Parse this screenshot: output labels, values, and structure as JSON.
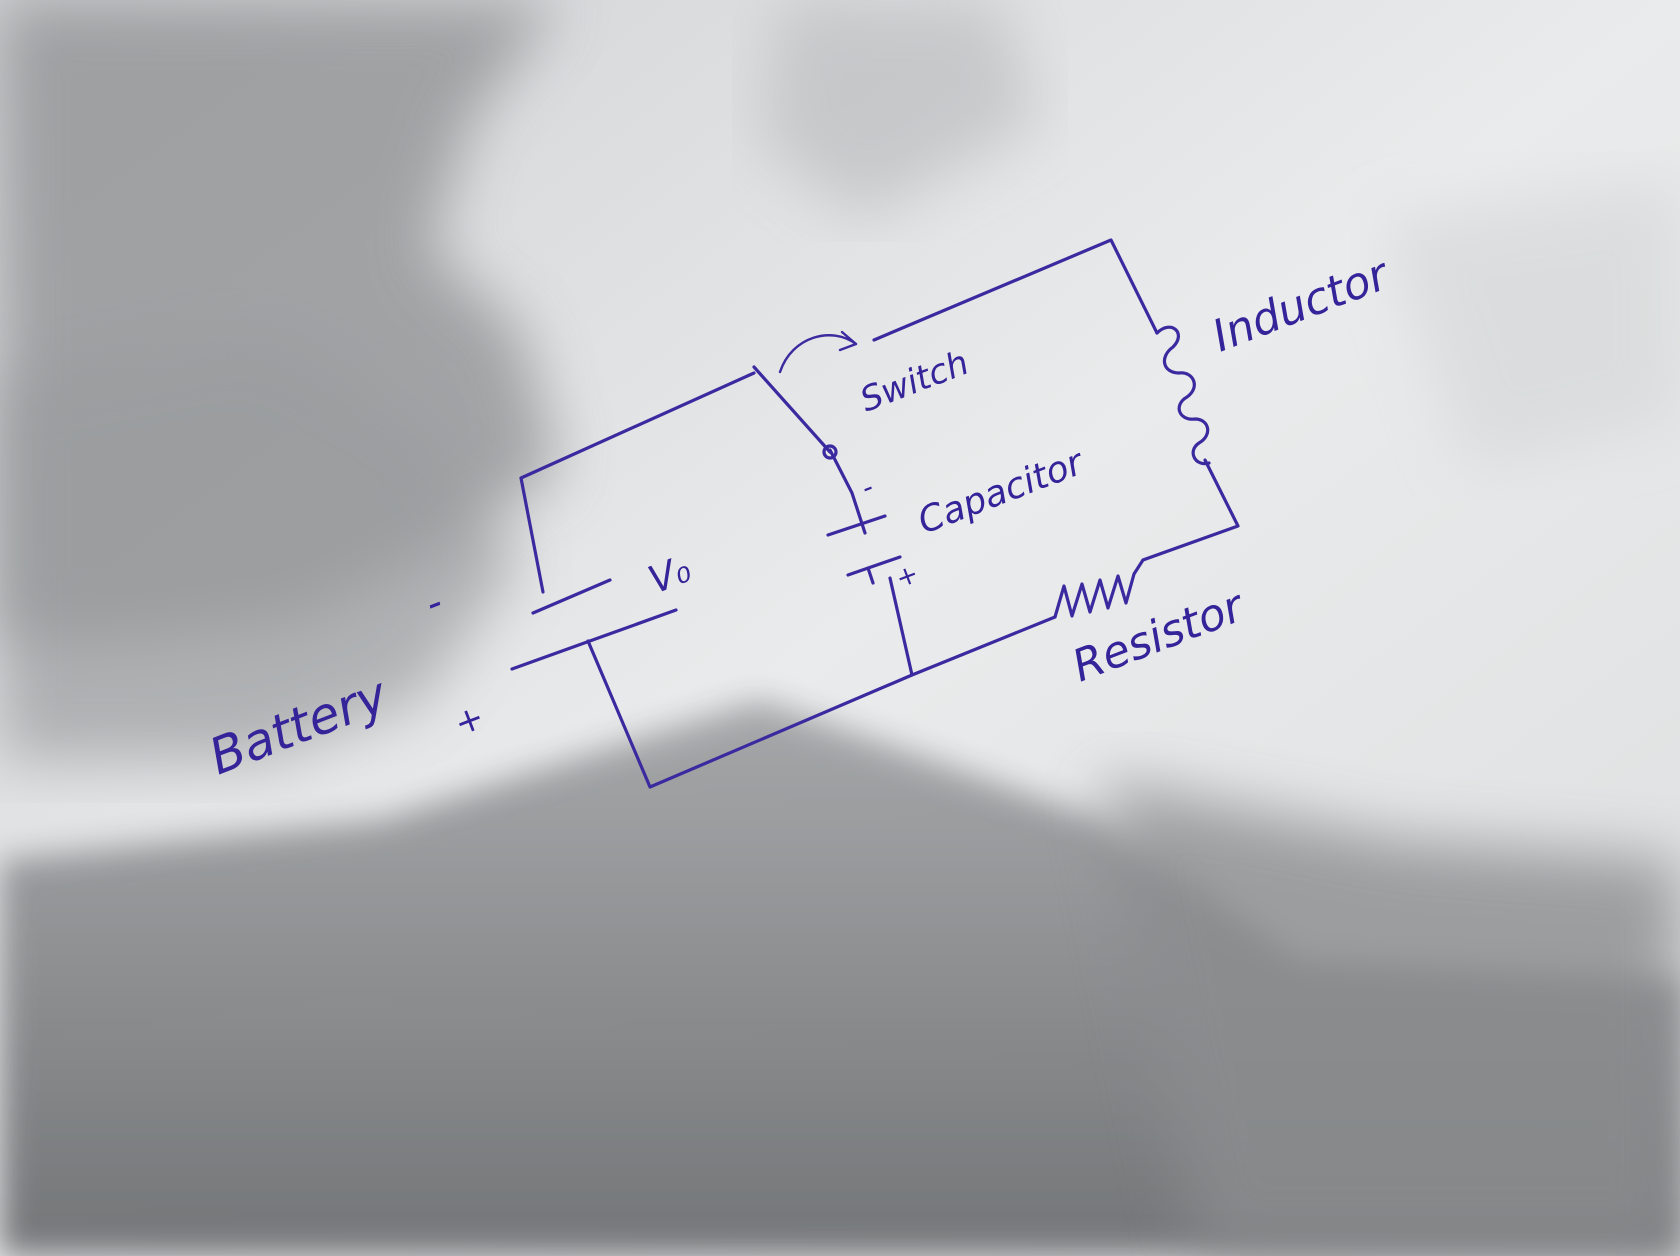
{
  "diagram": {
    "labels": {
      "battery": "Battery",
      "battery_neg": "-",
      "battery_pos": "+",
      "voltage": "V₀",
      "switch": "Switch",
      "capacitor": "Capacitor",
      "capacitor_neg": "-",
      "capacitor_pos": "+",
      "inductor": "Inductor",
      "resistor": "Resistor"
    },
    "colors": {
      "ink": "#3a2aa0",
      "paper": "#e4e6e8",
      "shadow": "#8c8e90"
    }
  }
}
